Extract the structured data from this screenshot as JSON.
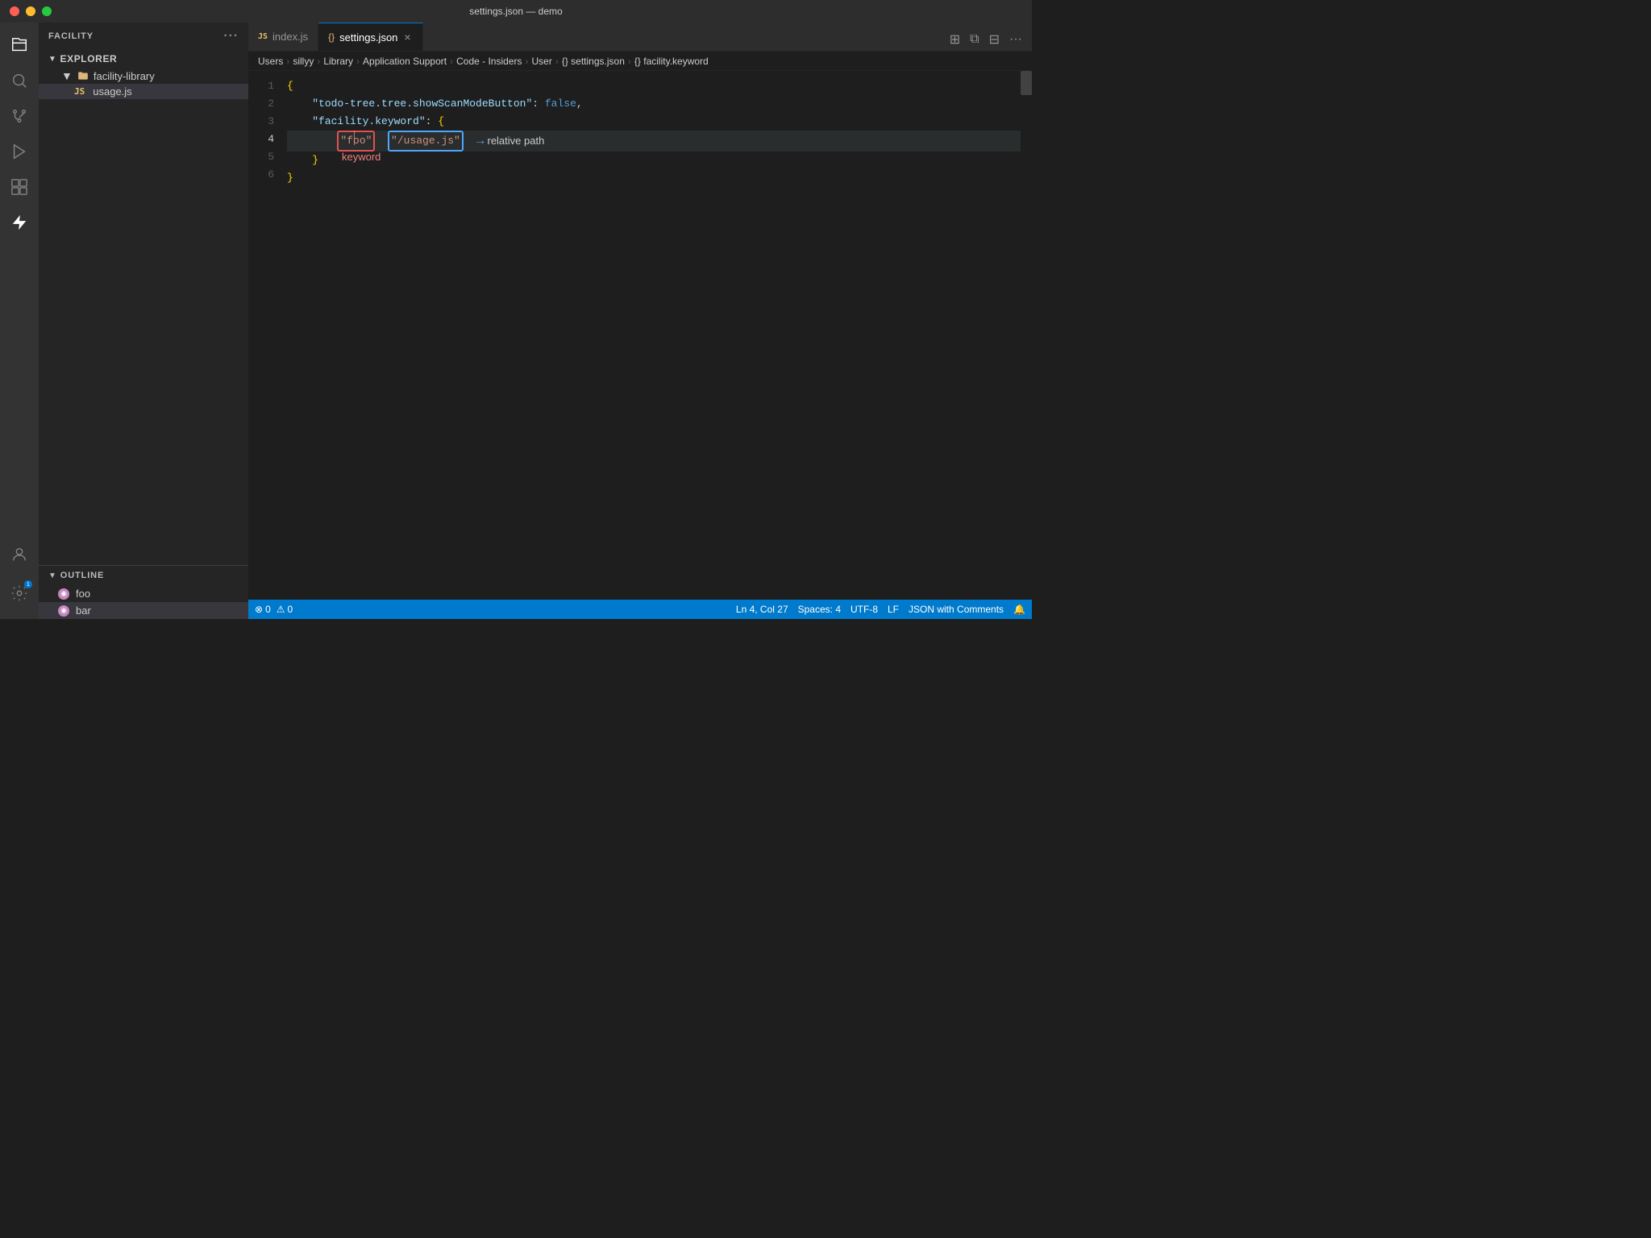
{
  "titlebar": {
    "title": "settings.json — demo"
  },
  "activity": {
    "icons": [
      "explorer",
      "search",
      "source-control",
      "run",
      "extensions",
      "lightning"
    ],
    "bottom_icons": [
      "account",
      "settings"
    ]
  },
  "sidebar": {
    "section_label": "FACILITY",
    "explorer_label": "EXPLORER",
    "folder": {
      "name": "facility-library",
      "files": [
        "usage.js"
      ]
    },
    "outline": {
      "label": "OUTLINE",
      "items": [
        "foo",
        "bar"
      ]
    }
  },
  "tabs": [
    {
      "label": "index.js",
      "icon": "JS",
      "active": false,
      "closeable": false
    },
    {
      "label": "settings.json",
      "icon": "{}",
      "active": true,
      "closeable": true
    }
  ],
  "breadcrumb": {
    "items": [
      "Users",
      "sillyy",
      "Library",
      "Application Support",
      "Code - Insiders",
      "User",
      "{} settings.json",
      "{} facility.keyword"
    ]
  },
  "editor": {
    "lines": [
      {
        "num": 1,
        "content": "{"
      },
      {
        "num": 2,
        "content": "    \"todo-tree.tree.showScanModeButton\": false,"
      },
      {
        "num": 3,
        "content": "    \"facility.keyword\": {"
      },
      {
        "num": 4,
        "content": "        \"foo\"  \"/usage.js\""
      },
      {
        "num": 5,
        "content": "    }"
      },
      {
        "num": 6,
        "content": "}"
      }
    ],
    "annotation_arrow": "→relative path",
    "annotation_keyword": "keyword",
    "cursor_line": 4
  },
  "statusbar": {
    "errors": "0",
    "warnings": "0",
    "ln": "Ln 4, Col 27",
    "spaces": "Spaces: 4",
    "encoding": "UTF-8",
    "eol": "LF",
    "language": "JSON with Comments",
    "feedback": "🔔"
  }
}
